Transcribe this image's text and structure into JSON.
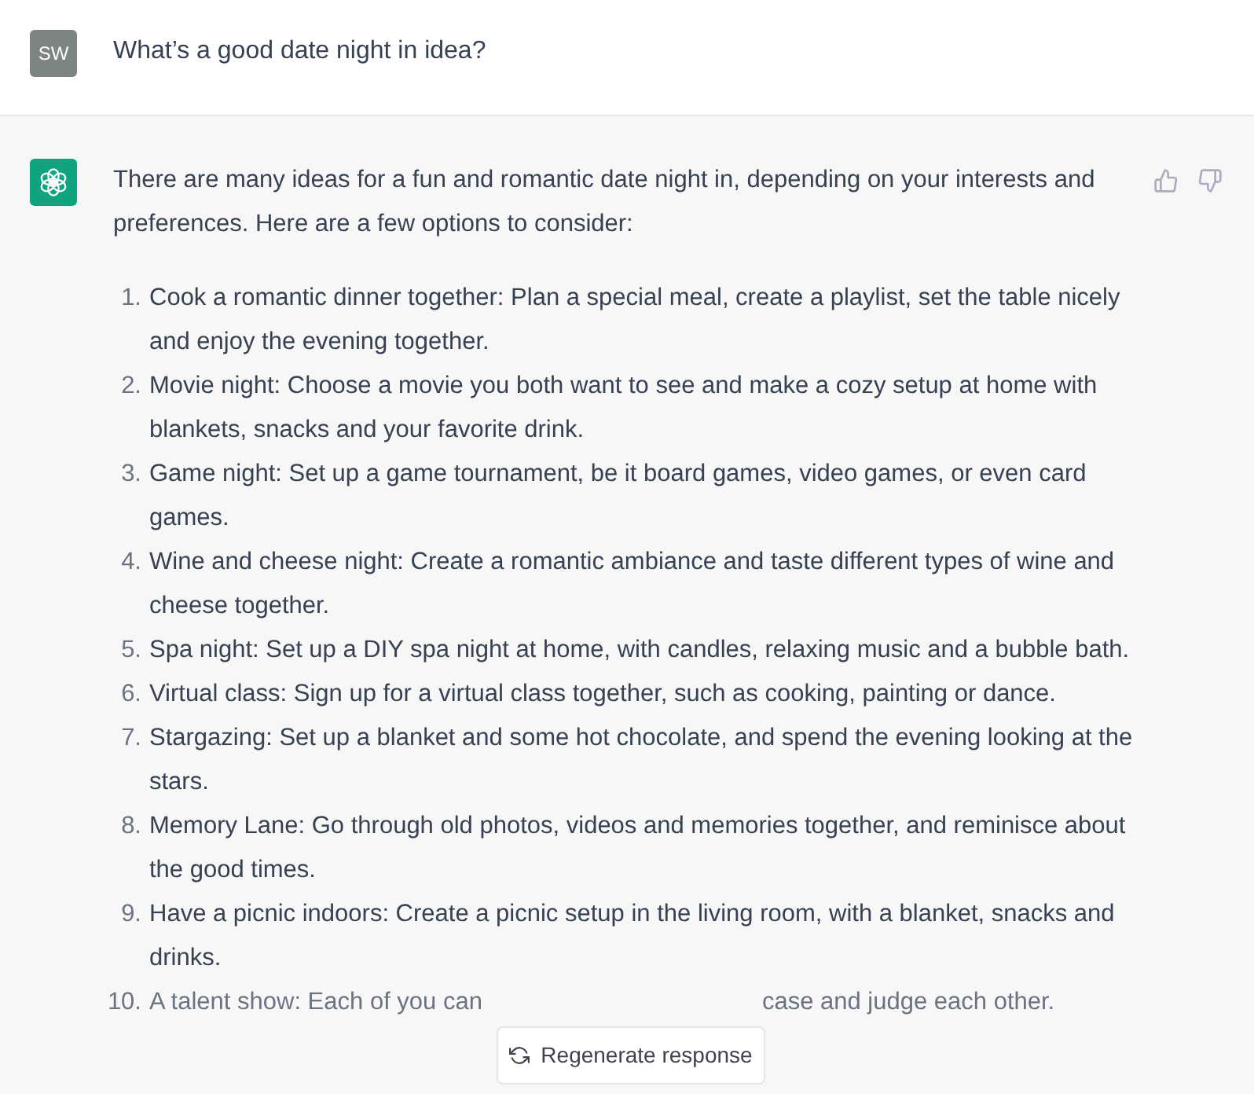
{
  "user_message": {
    "avatar": "SW",
    "text": "What’s a good date night in idea?"
  },
  "assistant_message": {
    "intro": "There are many ideas for a fun and romantic date night in, depending on your interests and preferences. Here are a few options to consider:",
    "items": [
      {
        "number": "1.",
        "text": "Cook a romantic dinner together: Plan a special meal, create a playlist, set the table nicely and enjoy the evening together."
      },
      {
        "number": "2.",
        "text": "Movie night: Choose a movie you both want to see and make a cozy setup at home with blankets, snacks and your favorite drink."
      },
      {
        "number": "3.",
        "text": "Game night: Set up a game tournament, be it board games, video games, or even card games."
      },
      {
        "number": "4.",
        "text": "Wine and cheese night: Create a romantic ambiance and taste different types of wine and cheese together."
      },
      {
        "number": "5.",
        "text": "Spa night: Set up a DIY spa night at home, with candles, relaxing music and a bubble bath."
      },
      {
        "number": "6.",
        "text": "Virtual class: Sign up for a virtual class together, such as cooking, painting or dance."
      },
      {
        "number": "7.",
        "text": "Stargazing: Set up a blanket and some hot chocolate, and spend the evening looking at the stars."
      },
      {
        "number": "8.",
        "text": "Memory Lane: Go through old photos, videos and memories together, and reminisce about the good times."
      },
      {
        "number": "9.",
        "text": "Have a picnic indoors: Create a picnic setup in the living room, with a blanket, snacks and drinks."
      }
    ],
    "last_item": {
      "number": "10.",
      "text_before": "A talent show: Each of you can",
      "text_after": "case and judge each other."
    }
  },
  "regenerate_button": {
    "label": "Regenerate response"
  }
}
